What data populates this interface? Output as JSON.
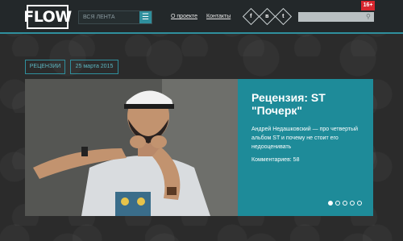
{
  "header": {
    "logo": "FLOW",
    "filter_label": "ВСЯ ЛЕНТА",
    "menu_icon": "hamburger-icon",
    "nav": [
      {
        "label": "О проекте"
      },
      {
        "label": "Контакты"
      }
    ],
    "social": [
      {
        "name": "facebook-icon",
        "glyph": "f"
      },
      {
        "name": "vk-icon",
        "glyph": "в"
      },
      {
        "name": "twitter-icon",
        "glyph": "t"
      }
    ],
    "search_icon": "search-icon",
    "age_badge": "16+"
  },
  "tags": {
    "category": "РЕЦЕНЗИИ",
    "date": "25 марта 2015"
  },
  "article": {
    "title": "Рецензия: ST \"Почерк\"",
    "description": "Андрей Недашковский — про четвертый альбом ST и почему не стоит его недооценивать",
    "comments": "Комментариев: 58"
  },
  "slider": {
    "slide_count": 5,
    "active_index": 0
  },
  "colors": {
    "accent": "#1e8b99",
    "header_bg": "#23282a",
    "badge": "#d8262e"
  }
}
